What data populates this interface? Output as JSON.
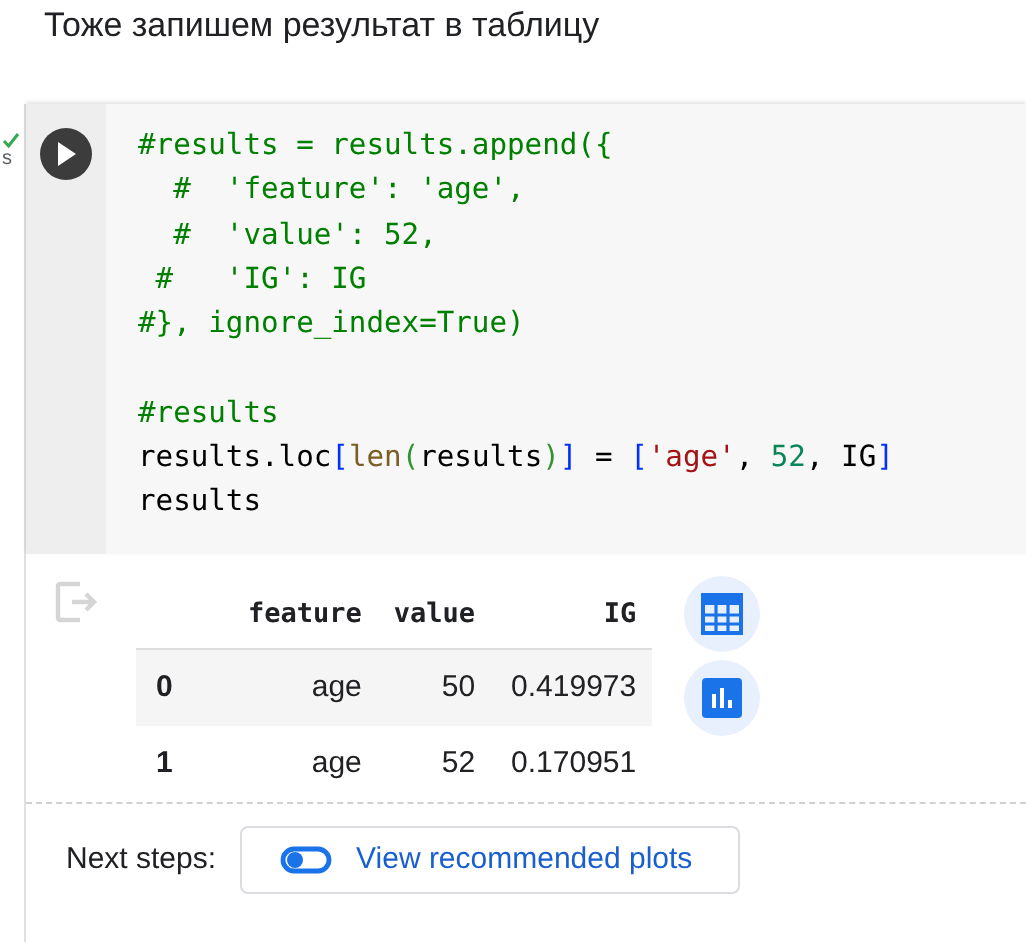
{
  "heading": "Тоже запишем результат в таблицу",
  "cell": {
    "status": {
      "success": true,
      "time": "s"
    },
    "code": [
      {
        "kind": "code",
        "tokens": [
          {
            "kind": "comment",
            "text": "#results = results.append({"
          }
        ]
      },
      {
        "kind": "code",
        "tokens": [
          {
            "kind": "comment",
            "text": "  #  'feature': 'age',"
          }
        ]
      },
      {
        "kind": "code",
        "tokens": [
          {
            "kind": "comment",
            "text": "  #  'value': 52,"
          }
        ]
      },
      {
        "kind": "code",
        "tokens": [
          {
            "kind": "comment",
            "text": " #   'IG': IG"
          }
        ]
      },
      {
        "kind": "code",
        "tokens": [
          {
            "kind": "comment",
            "text": "#}, ignore_index=True)"
          }
        ]
      },
      {
        "kind": "blank"
      },
      {
        "kind": "code",
        "tokens": [
          {
            "kind": "comment",
            "text": "#results"
          }
        ]
      },
      {
        "kind": "code",
        "tokens": [
          {
            "kind": "plain",
            "text": "results.loc"
          },
          {
            "kind": "bracket",
            "text": "["
          },
          {
            "kind": "builtin",
            "text": "len"
          },
          {
            "kind": "paren",
            "text": "("
          },
          {
            "kind": "plain",
            "text": "results"
          },
          {
            "kind": "paren",
            "text": ")"
          },
          {
            "kind": "bracket",
            "text": "]"
          },
          {
            "kind": "plain",
            "text": " = "
          },
          {
            "kind": "bracket",
            "text": "["
          },
          {
            "kind": "string",
            "text": "'age'"
          },
          {
            "kind": "plain",
            "text": ", "
          },
          {
            "kind": "number",
            "text": "52"
          },
          {
            "kind": "plain",
            "text": ", IG"
          },
          {
            "kind": "bracket",
            "text": "]"
          }
        ]
      },
      {
        "kind": "code",
        "tokens": [
          {
            "kind": "plain",
            "text": "results"
          }
        ]
      }
    ],
    "output": {
      "table": {
        "columns": [
          "",
          "feature",
          "value",
          "IG"
        ],
        "rows": [
          [
            "0",
            "age",
            "50",
            "0.419973"
          ],
          [
            "1",
            "age",
            "52",
            "0.170951"
          ]
        ]
      }
    },
    "next_steps": {
      "label": "Next steps:",
      "button": "View recommended plots"
    }
  }
}
